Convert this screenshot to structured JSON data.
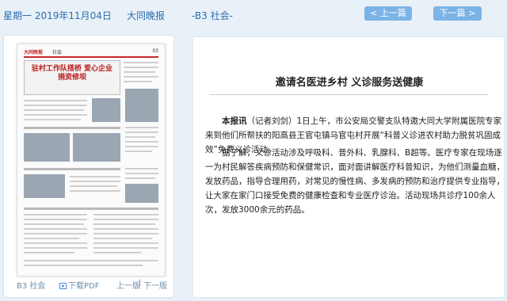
{
  "topbar": {
    "date": "星期一 2019年11月04日",
    "paper": "大同晚报",
    "page": "-B3 社会-",
    "prev_label": "< 上一篇",
    "next_label": "下一篇 >"
  },
  "thumbnail": {
    "logo": "大同晚报",
    "section": "社会",
    "page_no": "03",
    "headline": "驻村工作队搭桥 爱心企业捐资修坝"
  },
  "page_tools": {
    "page_label": "B3 社会",
    "pdf_label": "下载PDF",
    "prev_page": "上一版",
    "separator": "|",
    "next_page": "下一版"
  },
  "article": {
    "title": "邀请名医进乡村 义诊服务送健康",
    "lead": "本报讯",
    "p1_rest": "（记者刘剑）1日上午，市公安局交警支队特邀大同大学附属医院专家来到他们所帮扶的阳高县王官屯镇马官屯村开展“科普义诊进农村助力脱贫巩固成效”免费义诊活动。",
    "p2": "据了解，义诊活动涉及呼吸科、普外科、乳腺科、B超等。医疗专家在现场逐一为村民解答疾病预防和保健常识，面对面讲解医疗科普知识，为他们测量血糖，发放药品，指导合理用药，对常见的慢性病、多发病的预防和治疗提供专业指导，让大家在家门口接受免费的健康检查和专业医疗诊治。活动现场共诊疗100余人次，发放3000余元的药品。"
  },
  "colors": {
    "link": "#2b6cb0",
    "button": "#7cb3e6",
    "background": "#e9f1f8"
  }
}
